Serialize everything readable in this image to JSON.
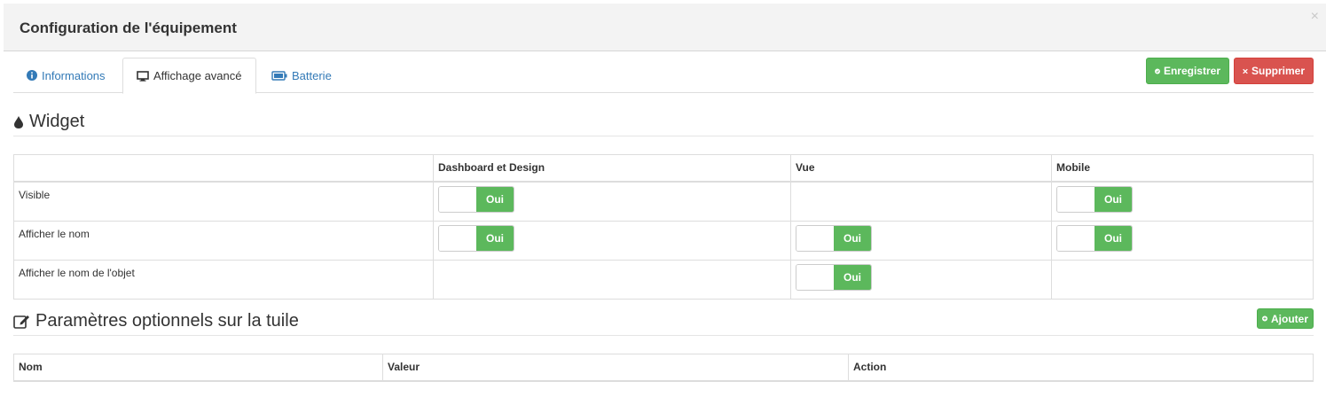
{
  "modal": {
    "title": "Configuration de l'équipement",
    "close": "×"
  },
  "tabs": [
    {
      "label": "Informations",
      "icon": "info-circle-icon"
    },
    {
      "label": "Affichage avancé",
      "icon": "desktop-icon"
    },
    {
      "label": "Batterie",
      "icon": "battery-icon"
    }
  ],
  "actions": {
    "save_label": "Enregistrer",
    "delete_label": "Supprimer"
  },
  "widget": {
    "title": "Widget",
    "headers": [
      "",
      "Dashboard et Design",
      "Vue",
      "Mobile"
    ],
    "rows": [
      {
        "label": "Visible",
        "dashboard": "Oui",
        "vue": "",
        "mobile": "Oui"
      },
      {
        "label": "Afficher le nom",
        "dashboard": "Oui",
        "vue": "Oui",
        "mobile": "Oui"
      },
      {
        "label": "Afficher le nom de l'objet",
        "dashboard": "",
        "vue": "Oui",
        "mobile": ""
      }
    ]
  },
  "params": {
    "title": "Paramètres optionnels sur la tuile",
    "add_label": "Ajouter",
    "headers": [
      "Nom",
      "Valeur",
      "Action"
    ]
  },
  "colors": {
    "success": "#5cb85c",
    "danger": "#d9534f",
    "link": "#337ab7"
  }
}
